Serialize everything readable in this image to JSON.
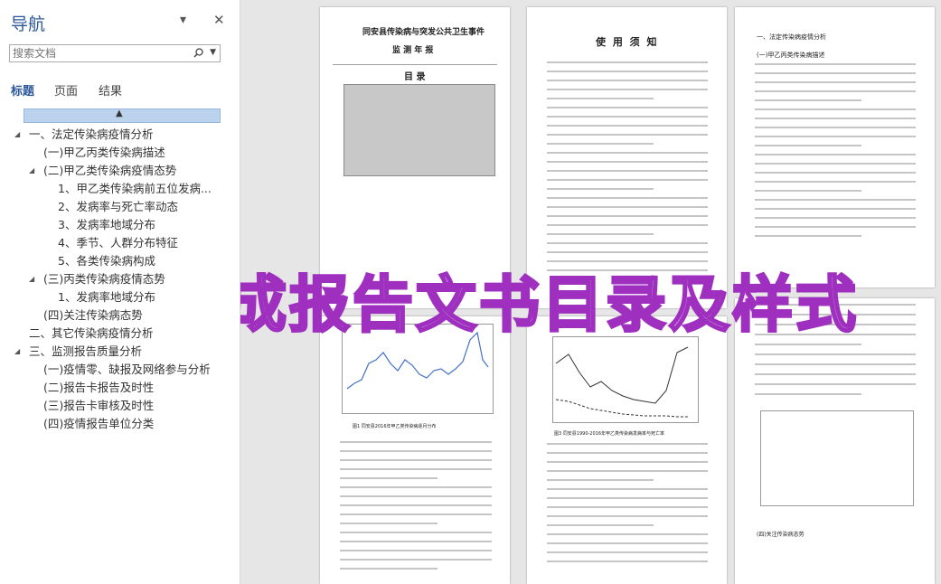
{
  "nav": {
    "title": "导航",
    "search_placeholder": "搜索文档",
    "tabs": [
      "标题",
      "页面",
      "结果"
    ],
    "tree": [
      {
        "text": "一、法定传染病疫情分析",
        "level": 1,
        "expanded": true
      },
      {
        "text": "(一)甲乙丙类传染病描述",
        "level": 2
      },
      {
        "text": "(二)甲乙类传染病疫情态势",
        "level": 2,
        "expanded": true
      },
      {
        "text": "1、甲乙类传染病前五位发病...",
        "level": 3
      },
      {
        "text": "2、发病率与死亡率动态",
        "level": 3
      },
      {
        "text": "3、发病率地域分布",
        "level": 3
      },
      {
        "text": "4、季节、人群分布特征",
        "level": 3
      },
      {
        "text": "5、各类传染病构成",
        "level": 3
      },
      {
        "text": "(三)丙类传染病疫情态势",
        "level": 2,
        "expanded": true
      },
      {
        "text": "1、发病率地域分布",
        "level": 3
      },
      {
        "text": "(四)关注传染病态势",
        "level": 2
      },
      {
        "text": "二、其它传染病疫情分析",
        "level": 1
      },
      {
        "text": "三、监测报告质量分析",
        "level": 1,
        "expanded": true
      },
      {
        "text": "(一)疫情零、缺报及网络参与分析",
        "level": 2
      },
      {
        "text": "(二)报告卡报告及时性",
        "level": 2
      },
      {
        "text": "(三)报告卡审核及时性",
        "level": 2
      },
      {
        "text": "(四)疫情报告单位分类",
        "level": 2
      }
    ]
  },
  "pages": {
    "cover_title": "同安县传染病与突发公共卫生事件",
    "cover_subtitle": "监 测 年 报",
    "cover_toc": "目 录",
    "notice_title": "使 用 须 知",
    "p3_heading": "一、法定传染病疫情分析",
    "p3_sub1": "(一)甲乙丙类传染病描述",
    "p5_caption": "图1 同安县2016年甲乙类传染病逐月分布",
    "p6_caption": "图3 同安县1990-2016年甲乙类传染病发病率与死亡率",
    "p7_heading": "(四)关注传染病态势"
  },
  "watermark": "生成报告文书目录及样式",
  "colors": {
    "accent": "#2b579a",
    "watermark_fill": "#f7dcff",
    "watermark_stroke": "#9e2fbf",
    "chart_line": "#4472c4"
  }
}
